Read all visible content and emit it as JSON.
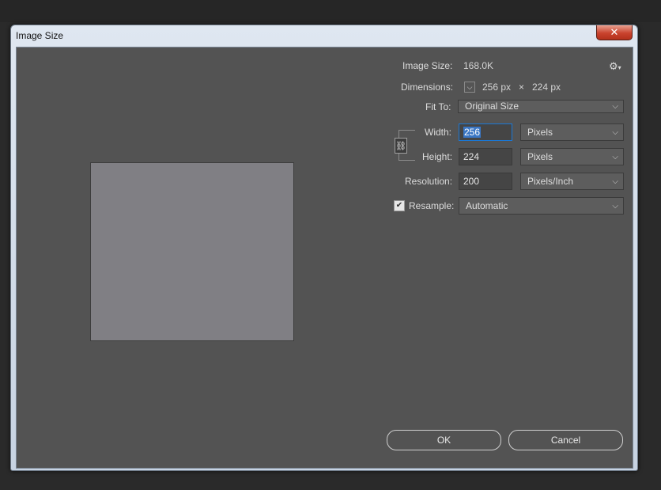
{
  "window": {
    "title": "Image Size",
    "close_glyph": "✕"
  },
  "info": {
    "image_size_label": "Image Size:",
    "image_size_value": "168.0K",
    "dimensions_label": "Dimensions:",
    "dim_width": "256 px",
    "dim_times": "×",
    "dim_height": "224 px"
  },
  "fit_to": {
    "label": "Fit To:",
    "value": "Original Size"
  },
  "width": {
    "label": "Width:",
    "value": "256",
    "unit": "Pixels"
  },
  "height": {
    "label": "Height:",
    "value": "224",
    "unit": "Pixels"
  },
  "resolution": {
    "label": "Resolution:",
    "value": "200",
    "unit": "Pixels/Inch"
  },
  "resample": {
    "label": "Resample:",
    "value": "Automatic",
    "checked": true
  },
  "buttons": {
    "ok": "OK",
    "cancel": "Cancel"
  },
  "icons": {
    "gear": "gear-icon",
    "chain": "chain-link-icon",
    "chevron": "chevron-down-icon"
  },
  "colors": {
    "dialog_bg": "#535353",
    "preview": "#807f84",
    "focus": "#1a78d6",
    "close": "#c9432e"
  }
}
